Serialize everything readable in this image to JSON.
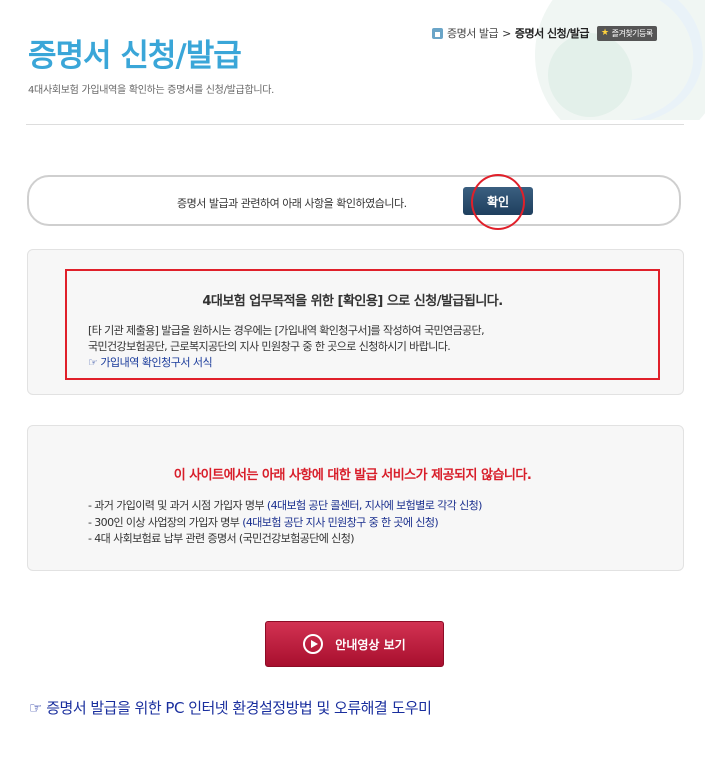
{
  "header": {
    "title": "증명서 신청/발급",
    "subtitle": "4대사회보험 가입내역을 확인하는 증명서를 신청/발급합니다.",
    "breadcrumb": {
      "home_icon": "home-icon",
      "parent": "증명서 발급",
      "separator": ">",
      "current": "증명서 신청/발급"
    },
    "bookmark_label": "즐겨찾기등록"
  },
  "confirm": {
    "text": "증명서 발급과 관련하여 아래 사항을 확인하였습니다.",
    "button_label": "확인"
  },
  "notice": {
    "title": "4대보험 업무목적을 위한 [확인용] 으로 신청/발급됩니다.",
    "line1": "[타 기관 제출용] 발급을 원하시는 경우에는 [가입내역 확인청구서]를 작성하여 국민연금공단,",
    "line2": "국민건강보험공단, 근로복지공단의 지사 민원창구 중 한 곳으로 신청하시기 바랍니다.",
    "form_link": "☞ 가입내역 확인청구서 서식"
  },
  "warning": {
    "title": "이 사이트에서는 아래 사항에 대한 발급 서비스가 제공되지 않습니다.",
    "items": [
      {
        "text": "- 과거 가입이력 및 과거 시점 가입자 명부 ",
        "note": "(4대보험 공단 콜센터, 지사에 보험별로 각각 신청)"
      },
      {
        "text": "- 300인 이상 사업장의 가입자 명부 ",
        "note": "(4대보험 공단 지사 민원창구 중 한 곳에 신청)"
      },
      {
        "text": "- 4대 사회보험료 납부 관련 증명서 (국민건강보험공단에 신청)",
        "note": ""
      }
    ]
  },
  "video_button_label": "안내영상 보기",
  "help_link": "☞ 증명서 발급을 위한 PC 인터넷 환경설정방법 및 오류해결 도우미",
  "colors": {
    "title_blue": "#3aa6d8",
    "confirm_button": "#2a4d6e",
    "alert_red": "#e0202a",
    "video_button": "#c0213f",
    "link_blue": "#1a2f9e"
  }
}
